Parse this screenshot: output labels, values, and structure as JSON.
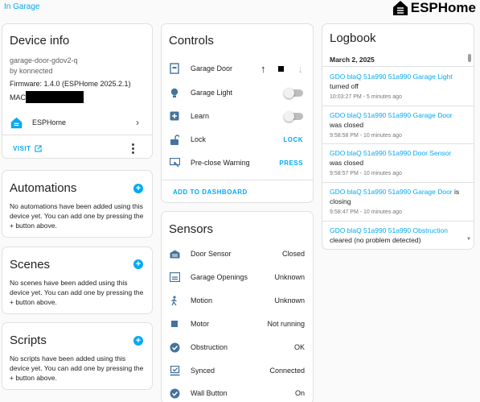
{
  "breadcrumb": "In Garage",
  "brand": {
    "name": "ESPHome"
  },
  "device_info": {
    "title": "Device info",
    "model": "garage-door-gdov2-q",
    "manufacturer": "by konnected",
    "firmware": "Firmware: 1.4.0 (ESPHome 2025.2.1)",
    "mac_label": "MAC:",
    "integration": "ESPHome",
    "visit_label": "VISIT"
  },
  "automations": {
    "title": "Automations",
    "desc": "No automations have been added using this device yet. You can add one by pressing the + button above."
  },
  "scenes": {
    "title": "Scenes",
    "desc": "No scenes have been added using this device yet. You can add one by pressing the + button above."
  },
  "scripts": {
    "title": "Scripts",
    "desc": "No scripts have been added using this device yet. You can add one by pressing the + button above."
  },
  "controls": {
    "title": "Controls",
    "items": [
      {
        "label": "Garage Door",
        "icon": "garage-door-icon"
      },
      {
        "label": "Garage Light",
        "icon": "lightbulb-icon"
      },
      {
        "label": "Learn",
        "icon": "plus-box-icon"
      },
      {
        "label": "Lock",
        "icon": "lock-open-icon",
        "action": "LOCK"
      },
      {
        "label": "Pre-close Warning",
        "icon": "monitor-icon",
        "action": "PRESS"
      }
    ],
    "add_dashboard": "ADD TO DASHBOARD"
  },
  "sensors": {
    "title": "Sensors",
    "items": [
      {
        "label": "Door Sensor",
        "value": "Closed",
        "icon": "garage-icon"
      },
      {
        "label": "Garage Openings",
        "value": "Unknown",
        "icon": "garage-counter-icon"
      },
      {
        "label": "Motion",
        "value": "Unknown",
        "icon": "walk-icon"
      },
      {
        "label": "Motor",
        "value": "Not running",
        "icon": "motor-icon"
      },
      {
        "label": "Obstruction",
        "value": "OK",
        "icon": "check-circle-icon"
      },
      {
        "label": "Synced",
        "value": "Connected",
        "icon": "sync-icon"
      },
      {
        "label": "Wall Button",
        "value": "On",
        "icon": "check-circle-icon"
      }
    ]
  },
  "logbook": {
    "title": "Logbook",
    "date": "March 2, 2025",
    "entries": [
      {
        "entity": "GDO blaQ 51a990 51a990 Garage Light",
        "text": "turned off",
        "time": "10:03:27 PM - 5 minutes ago"
      },
      {
        "entity": "GDO blaQ 51a990 51a990 Garage Door",
        "text": "was closed",
        "time": "9:58:58 PM - 10 minutes ago"
      },
      {
        "entity": "GDO blaQ 51a990 51a990 Door Sensor",
        "text": "was closed",
        "time": "9:58:57 PM - 10 minutes ago"
      },
      {
        "entity": "GDO blaQ 51a990 51a990 Garage Door",
        "text": "is closing",
        "time": "9:58:47 PM - 10 minutes ago"
      },
      {
        "entity": "GDO blaQ 51a990 51a990 Obstruction",
        "text": "cleared (no problem detected)",
        "time": ""
      }
    ]
  },
  "colors": {
    "accent": "#03a9f4",
    "icon": "#44739e"
  }
}
